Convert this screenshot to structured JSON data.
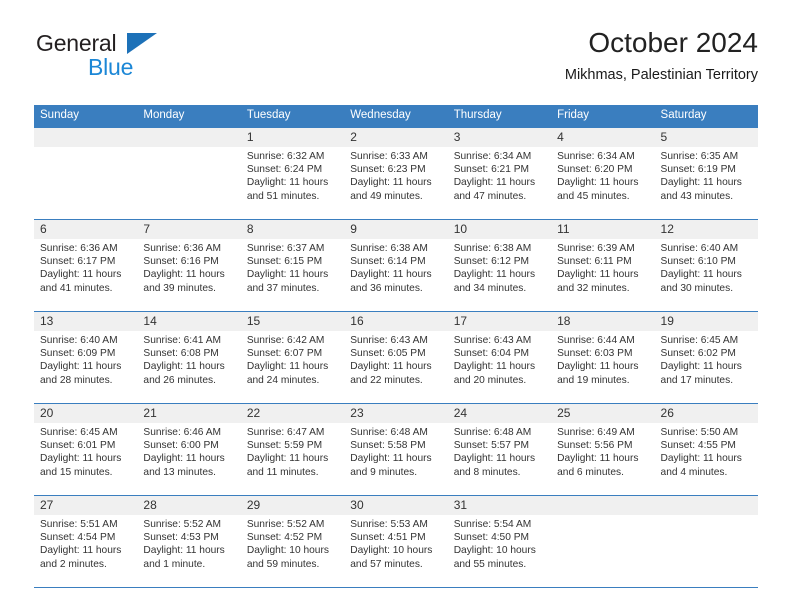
{
  "brand": {
    "name_part1": "General",
    "name_part2": "Blue",
    "triangle_color": "#1d71b8",
    "blue_color": "#1c87d6"
  },
  "header": {
    "title": "October 2024",
    "subtitle": "Mikhmas, Palestinian Territory"
  },
  "theme": {
    "header_row_bg": "#3a7ebf",
    "daynum_bg": "#f0f0f0",
    "grid_line": "#3a7ebf",
    "text": "#333333"
  },
  "weekdays": [
    "Sunday",
    "Monday",
    "Tuesday",
    "Wednesday",
    "Thursday",
    "Friday",
    "Saturday"
  ],
  "labels": {
    "sunrise_prefix": "Sunrise:",
    "sunset_prefix": "Sunset:",
    "daylight_prefix": "Daylight:"
  },
  "weeks": [
    [
      {
        "empty": true
      },
      {
        "empty": true
      },
      {
        "day": "1",
        "sunrise": "Sunrise: 6:32 AM",
        "sunset": "Sunset: 6:24 PM",
        "daylight": "Daylight: 11 hours and 51 minutes."
      },
      {
        "day": "2",
        "sunrise": "Sunrise: 6:33 AM",
        "sunset": "Sunset: 6:23 PM",
        "daylight": "Daylight: 11 hours and 49 minutes."
      },
      {
        "day": "3",
        "sunrise": "Sunrise: 6:34 AM",
        "sunset": "Sunset: 6:21 PM",
        "daylight": "Daylight: 11 hours and 47 minutes."
      },
      {
        "day": "4",
        "sunrise": "Sunrise: 6:34 AM",
        "sunset": "Sunset: 6:20 PM",
        "daylight": "Daylight: 11 hours and 45 minutes."
      },
      {
        "day": "5",
        "sunrise": "Sunrise: 6:35 AM",
        "sunset": "Sunset: 6:19 PM",
        "daylight": "Daylight: 11 hours and 43 minutes."
      }
    ],
    [
      {
        "day": "6",
        "sunrise": "Sunrise: 6:36 AM",
        "sunset": "Sunset: 6:17 PM",
        "daylight": "Daylight: 11 hours and 41 minutes."
      },
      {
        "day": "7",
        "sunrise": "Sunrise: 6:36 AM",
        "sunset": "Sunset: 6:16 PM",
        "daylight": "Daylight: 11 hours and 39 minutes."
      },
      {
        "day": "8",
        "sunrise": "Sunrise: 6:37 AM",
        "sunset": "Sunset: 6:15 PM",
        "daylight": "Daylight: 11 hours and 37 minutes."
      },
      {
        "day": "9",
        "sunrise": "Sunrise: 6:38 AM",
        "sunset": "Sunset: 6:14 PM",
        "daylight": "Daylight: 11 hours and 36 minutes."
      },
      {
        "day": "10",
        "sunrise": "Sunrise: 6:38 AM",
        "sunset": "Sunset: 6:12 PM",
        "daylight": "Daylight: 11 hours and 34 minutes."
      },
      {
        "day": "11",
        "sunrise": "Sunrise: 6:39 AM",
        "sunset": "Sunset: 6:11 PM",
        "daylight": "Daylight: 11 hours and 32 minutes."
      },
      {
        "day": "12",
        "sunrise": "Sunrise: 6:40 AM",
        "sunset": "Sunset: 6:10 PM",
        "daylight": "Daylight: 11 hours and 30 minutes."
      }
    ],
    [
      {
        "day": "13",
        "sunrise": "Sunrise: 6:40 AM",
        "sunset": "Sunset: 6:09 PM",
        "daylight": "Daylight: 11 hours and 28 minutes."
      },
      {
        "day": "14",
        "sunrise": "Sunrise: 6:41 AM",
        "sunset": "Sunset: 6:08 PM",
        "daylight": "Daylight: 11 hours and 26 minutes."
      },
      {
        "day": "15",
        "sunrise": "Sunrise: 6:42 AM",
        "sunset": "Sunset: 6:07 PM",
        "daylight": "Daylight: 11 hours and 24 minutes."
      },
      {
        "day": "16",
        "sunrise": "Sunrise: 6:43 AM",
        "sunset": "Sunset: 6:05 PM",
        "daylight": "Daylight: 11 hours and 22 minutes."
      },
      {
        "day": "17",
        "sunrise": "Sunrise: 6:43 AM",
        "sunset": "Sunset: 6:04 PM",
        "daylight": "Daylight: 11 hours and 20 minutes."
      },
      {
        "day": "18",
        "sunrise": "Sunrise: 6:44 AM",
        "sunset": "Sunset: 6:03 PM",
        "daylight": "Daylight: 11 hours and 19 minutes."
      },
      {
        "day": "19",
        "sunrise": "Sunrise: 6:45 AM",
        "sunset": "Sunset: 6:02 PM",
        "daylight": "Daylight: 11 hours and 17 minutes."
      }
    ],
    [
      {
        "day": "20",
        "sunrise": "Sunrise: 6:45 AM",
        "sunset": "Sunset: 6:01 PM",
        "daylight": "Daylight: 11 hours and 15 minutes."
      },
      {
        "day": "21",
        "sunrise": "Sunrise: 6:46 AM",
        "sunset": "Sunset: 6:00 PM",
        "daylight": "Daylight: 11 hours and 13 minutes."
      },
      {
        "day": "22",
        "sunrise": "Sunrise: 6:47 AM",
        "sunset": "Sunset: 5:59 PM",
        "daylight": "Daylight: 11 hours and 11 minutes."
      },
      {
        "day": "23",
        "sunrise": "Sunrise: 6:48 AM",
        "sunset": "Sunset: 5:58 PM",
        "daylight": "Daylight: 11 hours and 9 minutes."
      },
      {
        "day": "24",
        "sunrise": "Sunrise: 6:48 AM",
        "sunset": "Sunset: 5:57 PM",
        "daylight": "Daylight: 11 hours and 8 minutes."
      },
      {
        "day": "25",
        "sunrise": "Sunrise: 6:49 AM",
        "sunset": "Sunset: 5:56 PM",
        "daylight": "Daylight: 11 hours and 6 minutes."
      },
      {
        "day": "26",
        "sunrise": "Sunrise: 5:50 AM",
        "sunset": "Sunset: 4:55 PM",
        "daylight": "Daylight: 11 hours and 4 minutes."
      }
    ],
    [
      {
        "day": "27",
        "sunrise": "Sunrise: 5:51 AM",
        "sunset": "Sunset: 4:54 PM",
        "daylight": "Daylight: 11 hours and 2 minutes."
      },
      {
        "day": "28",
        "sunrise": "Sunrise: 5:52 AM",
        "sunset": "Sunset: 4:53 PM",
        "daylight": "Daylight: 11 hours and 1 minute."
      },
      {
        "day": "29",
        "sunrise": "Sunrise: 5:52 AM",
        "sunset": "Sunset: 4:52 PM",
        "daylight": "Daylight: 10 hours and 59 minutes."
      },
      {
        "day": "30",
        "sunrise": "Sunrise: 5:53 AM",
        "sunset": "Sunset: 4:51 PM",
        "daylight": "Daylight: 10 hours and 57 minutes."
      },
      {
        "day": "31",
        "sunrise": "Sunrise: 5:54 AM",
        "sunset": "Sunset: 4:50 PM",
        "daylight": "Daylight: 10 hours and 55 minutes."
      },
      {
        "empty": true
      },
      {
        "empty": true
      }
    ]
  ]
}
